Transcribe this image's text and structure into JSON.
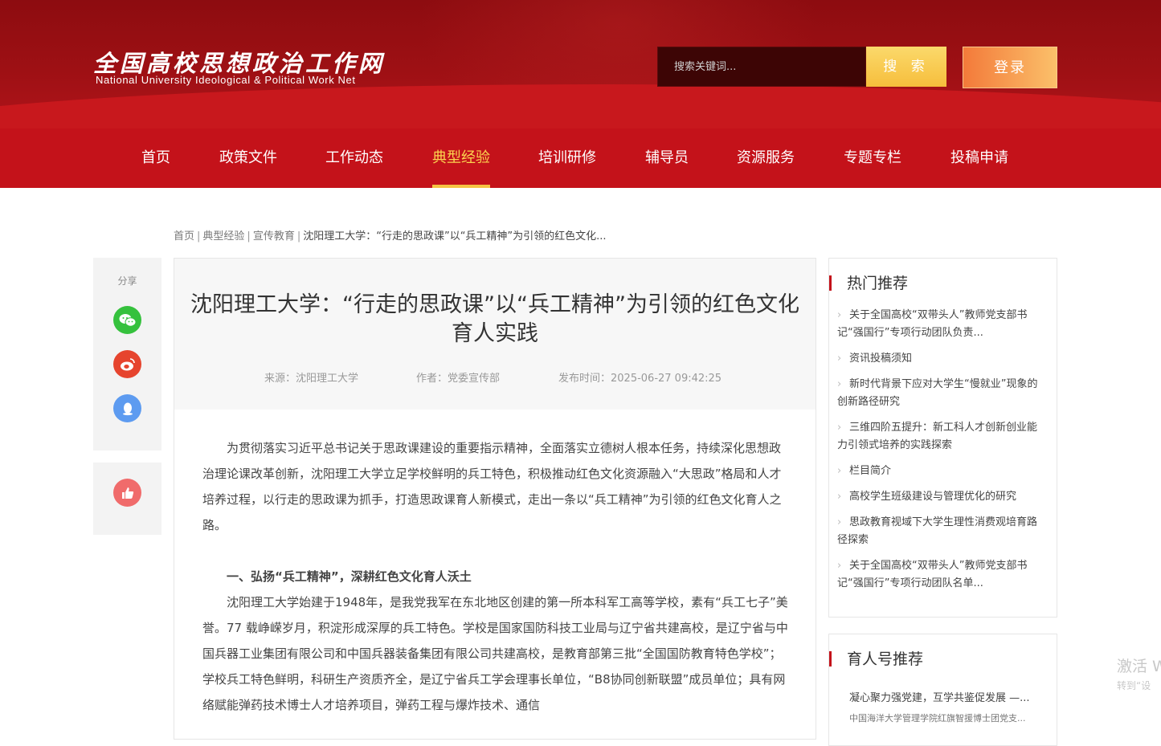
{
  "header": {
    "logo_cn": "全国高校思想政治工作网",
    "logo_en": "National University Ideological & Political Work Net",
    "search_placeholder": "搜索关键词...",
    "search_button": "搜 索",
    "login_button": "登录"
  },
  "nav": {
    "items": [
      "首页",
      "政策文件",
      "工作动态",
      "典型经验",
      "培训研修",
      "辅导员",
      "资源服务",
      "专题专栏",
      "投稿申请"
    ],
    "active": "典型经验"
  },
  "breadcrumb": {
    "items": [
      "首页",
      "典型经验",
      "宣传教育"
    ],
    "current": "沈阳理工大学：“行走的思政课”以“兵工精神”为引领的红色文化..."
  },
  "share": {
    "label": "分享",
    "icons": [
      "wechat-icon",
      "weibo-icon",
      "qq-icon"
    ],
    "like_icon": "thumbs-up-icon"
  },
  "article": {
    "title": "沈阳理工大学：“行走的思政课”以“兵工精神”为引领的红色文化育人实践",
    "source": "来源：沈阳理工大学",
    "author": "作者：党委宣传部",
    "date": "发布时间：2025-06-27 09:42:25",
    "para1": "为贯彻落实习近平总书记关于思政课建设的重要指示精神，全面落实立德树人根本任务，持续深化思想政治理论课改革创新，沈阳理工大学立足学校鲜明的兵工特色，积极推动红色文化资源融入“大思政”格局和人才培养过程，以行走的思政课为抓手，打造思政课育人新模式，走出一条以“兵工精神”为引领的红色文化育人之路。",
    "heading1": "一、弘扬“兵工精神”，深耕红色文化育人沃土",
    "para2": "沈阳理工大学始建于1948年，是我党我军在东北地区创建的第一所本科军工高等学校，素有“兵工七子”美誉。77 载峥嵘岁月，积淀形成深厚的兵工特色。学校是国家国防科技工业局与辽宁省共建高校，是辽宁省与中国兵器工业集团有限公司和中国兵器装备集团有限公司共建高校，是教育部第三批“全国国防教育特色学校”；学校兵工特色鲜明，科研生产资质齐全，是辽宁省兵工学会理事长单位，“B8协同创新联盟”成员单位；具有网络赋能弹药技术博士人才培养项目，弹药工程与爆炸技术、通信"
  },
  "hot": {
    "title": "热门推荐",
    "items": [
      "关于全国高校“双带头人”教师党支部书记“强国行”专项行动团队负责...",
      "资讯投稿须知",
      "新时代背景下应对大学生“慢就业”现象的创新路径研究",
      "三维四阶五提升：新工科人才创新创业能力引领式培养的实践探索",
      "栏目简介",
      "高校学生班级建设与管理优化的研究",
      "思政教育视域下大学生理性消费观培育路径探索",
      "关于全国高校“双带头人”教师党支部书记“强国行”专项行动团队名单..."
    ]
  },
  "yuyu": {
    "title": "育人号推荐",
    "item1": "凝心聚力强党建，互学共鉴促发展 —...",
    "item1_sub": "中国海洋大学管理学院红旗智援博士团党支..."
  },
  "watermark": {
    "line1": "激活 W",
    "line2": "转到“设"
  }
}
